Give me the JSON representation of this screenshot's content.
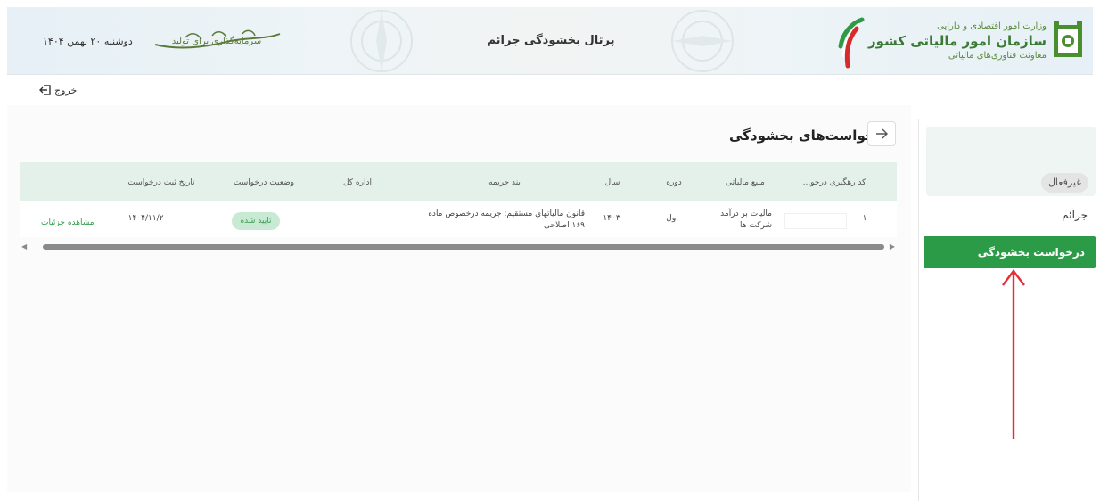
{
  "header": {
    "org_line1": "وزارت امور اقتصادی و دارایی",
    "org_line2": "سازمان امور مالیاتی کشور",
    "org_line3": "معاونت فناوری‌های مالیاتی",
    "portal_title": "پرتال بخشودگی جرائم",
    "slogan": "سرمایه‌گذاری برای تولید",
    "date": "دوشنبه ۲۰ بهمن ۱۴۰۴"
  },
  "exit_label": "خروج",
  "sidebar": {
    "status_badge": "غیرفعال",
    "section_label": "جرائم",
    "active_item": "درخواست بخشودگی"
  },
  "main": {
    "title": "درخواست‌های بخشودگی",
    "table": {
      "headers": {
        "tracking_code": "کد رهگیری درخو...",
        "tax_source": "منبع مالیاتی",
        "period": "دوره",
        "year": "سال",
        "penalty_clause": "بند جریمه",
        "general_office": "اداره کل",
        "request_status": "وضعیت درخواست",
        "request_date": "تاریخ ثبت درخواست"
      },
      "rows": [
        {
          "index": "۱",
          "tax_source_l1": "مالیات بر درآمد",
          "tax_source_l2": "شرکت ها",
          "period": "اول",
          "year": "۱۴۰۳",
          "penalty_l1": "قانون مالیاتهای مستقیم: جریمه درخصوص ماده",
          "penalty_l2": "۱۶۹ اصلاحی",
          "status": "تایید شده",
          "date": "۱۴۰۴/۱۱/۲۰",
          "details": "مشاهده جزئیات"
        }
      ]
    }
  },
  "colors": {
    "primary_green": "#2b9b47",
    "annotation_red": "#e0303a"
  }
}
